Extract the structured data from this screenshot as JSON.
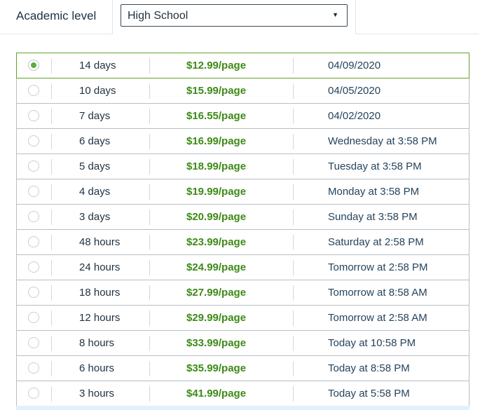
{
  "academic_level": {
    "label": "Academic level",
    "selected": "High School"
  },
  "colors": {
    "price": "#3d8a16",
    "selected_border": "#62a32e",
    "radio_on": "#5cae3a"
  },
  "options": [
    {
      "deadline": "14 days",
      "price": "$12.99/page",
      "date": "04/09/2020",
      "selected": true
    },
    {
      "deadline": "10 days",
      "price": "$15.99/page",
      "date": "04/05/2020",
      "selected": false
    },
    {
      "deadline": "7 days",
      "price": "$16.55/page",
      "date": "04/02/2020",
      "selected": false
    },
    {
      "deadline": "6 days",
      "price": "$16.99/page",
      "date": "Wednesday at 3:58 PM",
      "selected": false
    },
    {
      "deadline": "5 days",
      "price": "$18.99/page",
      "date": "Tuesday at 3:58 PM",
      "selected": false
    },
    {
      "deadline": "4 days",
      "price": "$19.99/page",
      "date": "Monday at 3:58 PM",
      "selected": false
    },
    {
      "deadline": "3 days",
      "price": "$20.99/page",
      "date": "Sunday at 3:58 PM",
      "selected": false
    },
    {
      "deadline": "48 hours",
      "price": "$23.99/page",
      "date": "Saturday at 2:58 PM",
      "selected": false
    },
    {
      "deadline": "24 hours",
      "price": "$24.99/page",
      "date": "Tomorrow at 2:58 PM",
      "selected": false
    },
    {
      "deadline": "18 hours",
      "price": "$27.99/page",
      "date": "Tomorrow at 8:58 AM",
      "selected": false
    },
    {
      "deadline": "12 hours",
      "price": "$29.99/page",
      "date": "Tomorrow at 2:58 AM",
      "selected": false
    },
    {
      "deadline": "8 hours",
      "price": "$33.99/page",
      "date": "Today at 10:58 PM",
      "selected": false
    },
    {
      "deadline": "6 hours",
      "price": "$35.99/page",
      "date": "Today at 8:58 PM",
      "selected": false
    },
    {
      "deadline": "3 hours",
      "price": "$41.99/page",
      "date": "Today at 5:58 PM",
      "selected": false
    }
  ]
}
